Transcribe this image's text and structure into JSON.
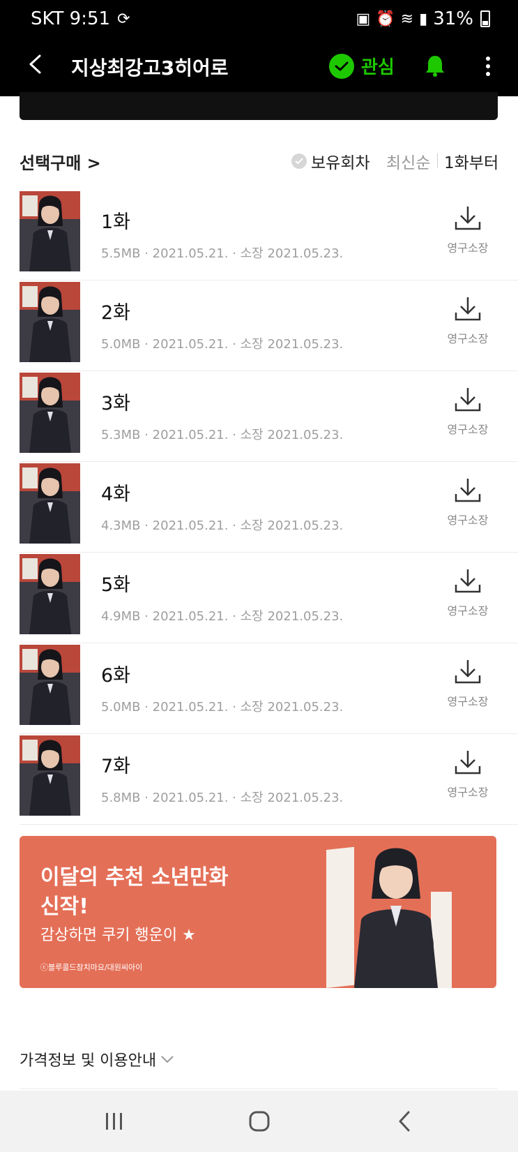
{
  "status": {
    "carrier_time": "SKT 9:51",
    "battery": "31%"
  },
  "header": {
    "title": "지상최강고3히어로",
    "favorite_label": "관심"
  },
  "filter": {
    "select_purchase": "선택구매 >",
    "owned": "보유회차",
    "sort_latest": "최신순",
    "sort_first": "1화부터"
  },
  "episodes": [
    {
      "title": "1화",
      "meta": "5.5MB · 2021.05.21. · 소장 2021.05.23.",
      "download_label": "영구소장"
    },
    {
      "title": "2화",
      "meta": "5.0MB · 2021.05.21. · 소장 2021.05.23.",
      "download_label": "영구소장"
    },
    {
      "title": "3화",
      "meta": "5.3MB · 2021.05.21. · 소장 2021.05.23.",
      "download_label": "영구소장"
    },
    {
      "title": "4화",
      "meta": "4.3MB · 2021.05.21. · 소장 2021.05.23.",
      "download_label": "영구소장"
    },
    {
      "title": "5화",
      "meta": "4.9MB · 2021.05.21. · 소장 2021.05.23.",
      "download_label": "영구소장"
    },
    {
      "title": "6화",
      "meta": "5.0MB · 2021.05.21. · 소장 2021.05.23.",
      "download_label": "영구소장"
    },
    {
      "title": "7화",
      "meta": "5.8MB · 2021.05.21. · 소장 2021.05.23.",
      "download_label": "영구소장"
    }
  ],
  "promo": {
    "title_line1": "이달의 추천 소년만화",
    "title_line2": "신작!",
    "subtitle": "감상하면 쿠키 행운이 ★",
    "credit": "ⓒ블루콜드참치마요/대원씨아이",
    "background_color": "#e46f57"
  },
  "price_info": "가격정보 및 이용안내",
  "colors": {
    "accent_green": "#1ec800",
    "header_bg": "#000000"
  },
  "icons": [
    "back-arrow-icon",
    "check-icon",
    "bell-icon",
    "more-vertical-icon",
    "download-icon",
    "chevron-down-icon",
    "recent-apps-icon",
    "home-icon",
    "nav-back-icon"
  ]
}
